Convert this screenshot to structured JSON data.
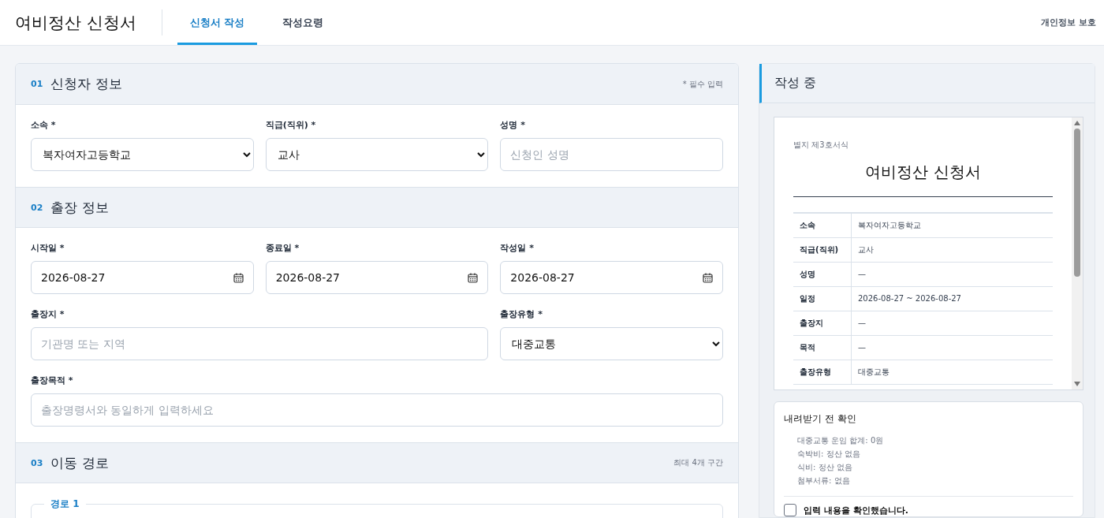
{
  "header": {
    "title": "여비정산 신청서",
    "tabs": [
      {
        "label": "신청서 작성",
        "selected": true
      },
      {
        "label": "작성요령",
        "selected": false
      }
    ],
    "privacy_link": "개인정보 보호"
  },
  "sections": [
    {
      "number": "01",
      "title": "신청자 정보",
      "note": "* 필수 입력",
      "rows": [
        [
          {
            "label": "소속 *",
            "kind": "select",
            "value": "복자여자고등학교"
          },
          {
            "label": "직급(직위) *",
            "kind": "select",
            "value": "교사"
          },
          {
            "label": "성명 *",
            "kind": "text",
            "placeholder": "신청인 성명"
          }
        ]
      ]
    },
    {
      "number": "02",
      "title": "출장 정보",
      "rows": [
        [
          {
            "label": "시작일 *",
            "kind": "date",
            "value": "2026-08-27"
          },
          {
            "label": "종료일 *",
            "kind": "date",
            "value": "2026-08-27"
          },
          {
            "label": "작성일 *",
            "kind": "date",
            "value": "2026-08-27"
          }
        ],
        [
          {
            "label": "출장지 *",
            "kind": "text",
            "placeholder": "기관명 또는 지역",
            "colspan": 2
          },
          {
            "label": "출장유형 *",
            "kind": "select",
            "value": "대중교통"
          }
        ],
        [
          {
            "label": "출장목적 *",
            "kind": "text",
            "placeholder": "출장명령서와 동일하게 입력하세요",
            "colspan": 3
          }
        ]
      ]
    },
    {
      "number": "03",
      "title": "이동 경로",
      "note": "최대 4개 구간",
      "route_legend": "경로 1"
    }
  ],
  "preview": {
    "title": "작성 중",
    "form_label": "별지 제3호서식",
    "doc_title": "여비정산 신청서",
    "rows": [
      {
        "label": "소속",
        "value": "복자여자고등학교"
      },
      {
        "label": "직급(직위)",
        "value": "교사"
      },
      {
        "label": "성명",
        "value": "—"
      },
      {
        "label": "일정",
        "value": "2026-08-27 ~ 2026-08-27"
      },
      {
        "label": "출장지",
        "value": "—"
      },
      {
        "label": "목적",
        "value": "—"
      },
      {
        "label": "출장유형",
        "value": "대중교통"
      }
    ]
  },
  "check": {
    "title": "내려받기 전 확인",
    "items": [
      "대중교통 운임 합계: 0원",
      "숙박비: 정산 없음",
      "식비: 정산 없음",
      "첨부서류: 없음"
    ],
    "confirm": {
      "label": "입력 내용을 확인했습니다.",
      "checked": false
    }
  }
}
